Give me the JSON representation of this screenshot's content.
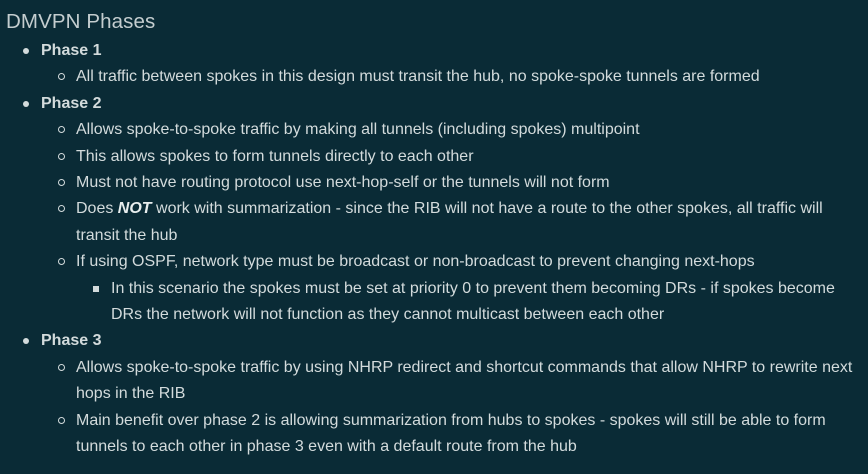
{
  "title": "DMVPN Phases",
  "phases": [
    {
      "title": "Phase 1",
      "items": [
        {
          "text": "All traffic between spokes in this design must transit the hub, no spoke-spoke tunnels are formed"
        }
      ]
    },
    {
      "title": "Phase 2",
      "items": [
        {
          "text": "Allows spoke-to-spoke traffic by making all tunnels (including spokes) multipoint"
        },
        {
          "text": "This allows spokes to form tunnels directly to each other"
        },
        {
          "text": "Must not have routing protocol use next-hop-self or the tunnels will not form"
        },
        {
          "prefix": "Does ",
          "emph": "NOT",
          "suffix": " work with summarization - since the RIB will not have a route to the other spokes, all traffic will transit the hub"
        },
        {
          "text": "If using OSPF, network type must be broadcast or non-broadcast to prevent changing next-hops",
          "subitems": [
            {
              "text": "In this scenario the spokes must be set at priority 0 to prevent them becoming DRs - if spokes become DRs the network will not function as they cannot multicast between each other"
            }
          ]
        }
      ]
    },
    {
      "title": "Phase 3",
      "items": [
        {
          "text": "Allows spoke-to-spoke traffic by using NHRP redirect and shortcut commands that allow NHRP to rewrite next hops in the RIB"
        },
        {
          "text": "Main benefit over phase 2 is allowing summarization from hubs to spokes - spokes will still be able to form tunnels to each other in phase 3 even with a default route from the hub"
        }
      ]
    }
  ]
}
